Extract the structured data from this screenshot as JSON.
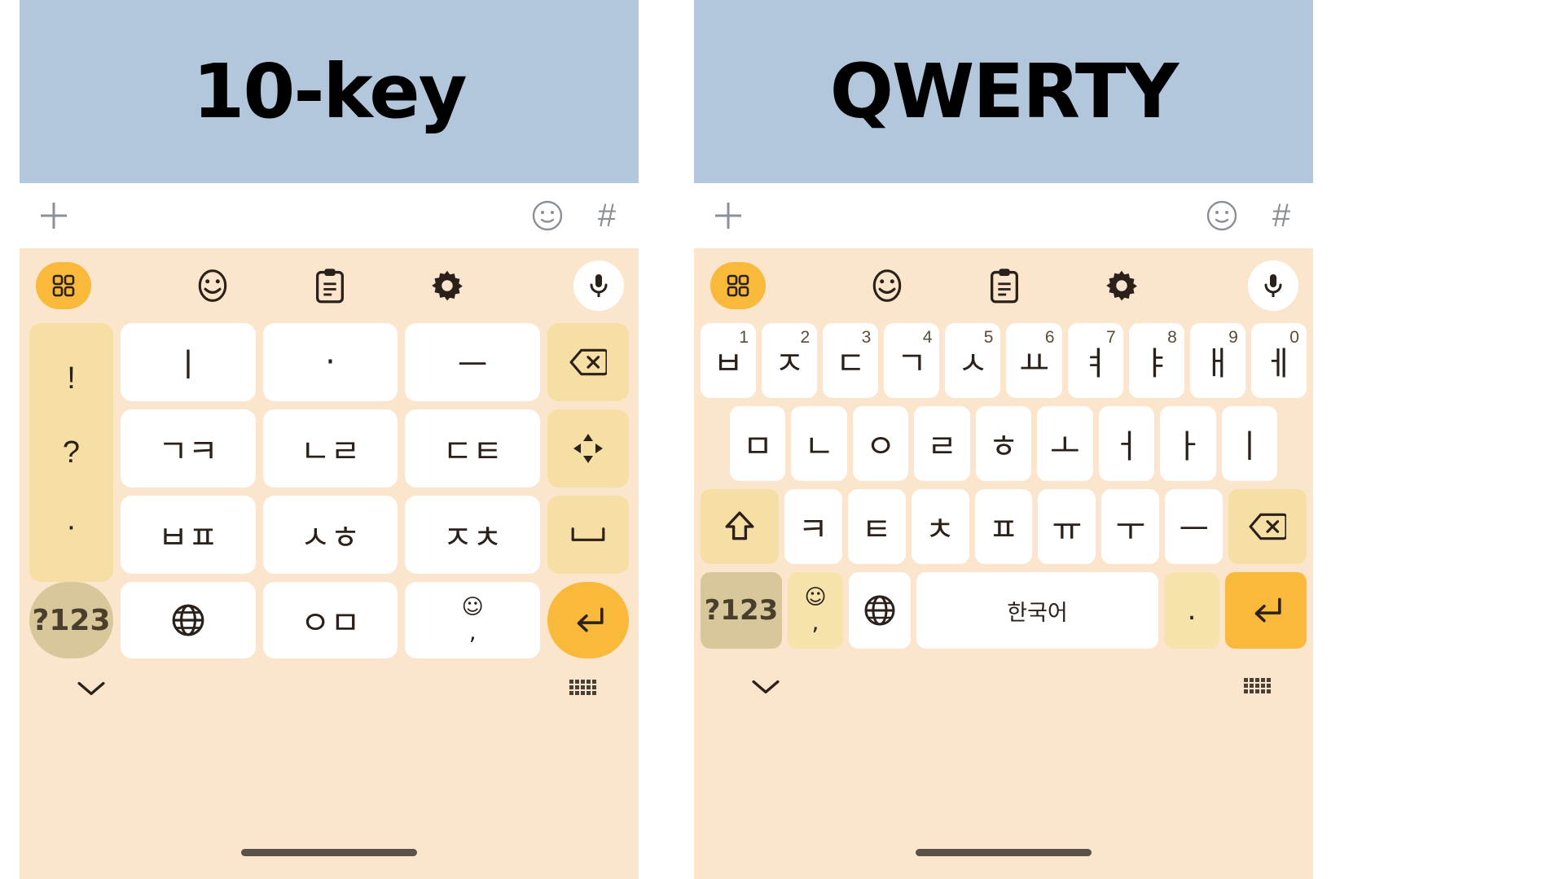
{
  "panels": [
    {
      "id": "ten-key",
      "banner_title": "10-key",
      "banner_color": "#b2c7dc",
      "app_toolbar": {
        "plus_icon": "plus-icon",
        "emoji_icon": "emoji-face-icon",
        "hash_label": "#"
      },
      "kb_toolbar": [
        {
          "name": "apps-grid-icon",
          "label": "",
          "style": "pill-orange"
        },
        {
          "name": "emoji-icon",
          "label": "",
          "style": "plain"
        },
        {
          "name": "clipboard-icon",
          "label": "",
          "style": "plain"
        },
        {
          "name": "settings-gear-icon",
          "label": "",
          "style": "plain"
        },
        {
          "name": "microphone-icon",
          "label": "",
          "style": "pill-white"
        }
      ],
      "punct_column": [
        "!",
        "?",
        "·"
      ],
      "rows": [
        [
          "ㅣ",
          "·",
          "ㅡ"
        ],
        [
          "ㄱㅋ",
          "ㄴㄹ",
          "ㄷㅌ"
        ],
        [
          "ㅂㅍ",
          "ㅅㅎ",
          "ㅈㅊ"
        ]
      ],
      "right_column": [
        {
          "name": "backspace-key",
          "label": "⌫"
        },
        {
          "name": "cursor-move-key",
          "label": "✛"
        },
        {
          "name": "space-key",
          "label": "␣"
        }
      ],
      "bottom_row": [
        {
          "name": "symbols-key",
          "label": "?123"
        },
        {
          "name": "language-globe-key",
          "label": "🌐"
        },
        {
          "name": "ieung-mieum-key",
          "label": "ㅇㅁ"
        },
        {
          "name": "emoji-comma-key",
          "label_top": "☺",
          "label_bottom": ","
        },
        {
          "name": "enter-key",
          "label": "↵"
        }
      ],
      "footer": {
        "collapse_icon": "chevron-down-icon",
        "keyboard_switch_icon": "mini-keyboard-icon"
      }
    },
    {
      "id": "qwerty",
      "banner_title": "QWERTY",
      "banner_color": "#b2c7dc",
      "app_toolbar": {
        "plus_icon": "plus-icon",
        "emoji_icon": "emoji-face-icon",
        "hash_label": "#"
      },
      "kb_toolbar": [
        {
          "name": "apps-grid-icon",
          "label": "",
          "style": "pill-orange"
        },
        {
          "name": "emoji-icon",
          "label": "",
          "style": "plain"
        },
        {
          "name": "clipboard-icon",
          "label": "",
          "style": "plain"
        },
        {
          "name": "settings-gear-icon",
          "label": "",
          "style": "plain"
        },
        {
          "name": "microphone-icon",
          "label": "",
          "style": "pill-white"
        }
      ],
      "row1": [
        {
          "char": "ㅂ",
          "num": "1"
        },
        {
          "char": "ㅈ",
          "num": "2"
        },
        {
          "char": "ㄷ",
          "num": "3"
        },
        {
          "char": "ㄱ",
          "num": "4"
        },
        {
          "char": "ㅅ",
          "num": "5"
        },
        {
          "char": "ㅛ",
          "num": "6"
        },
        {
          "char": "ㅕ",
          "num": "7"
        },
        {
          "char": "ㅑ",
          "num": "8"
        },
        {
          "char": "ㅐ",
          "num": "9"
        },
        {
          "char": "ㅔ",
          "num": "0"
        }
      ],
      "row2": [
        "ㅁ",
        "ㄴ",
        "ㅇ",
        "ㄹ",
        "ㅎ",
        "ㅗ",
        "ㅓ",
        "ㅏ",
        "ㅣ"
      ],
      "row3": {
        "shift": {
          "name": "shift-key",
          "label": "⇧"
        },
        "chars": [
          "ㅋ",
          "ㅌ",
          "ㅊ",
          "ㅍ",
          "ㅠ",
          "ㅜ",
          "ㅡ"
        ],
        "backspace": {
          "name": "backspace-key",
          "label": "⌫"
        }
      },
      "row4": [
        {
          "name": "symbols-key",
          "label": "?123"
        },
        {
          "name": "emoji-comma-key",
          "label_top": "☺",
          "label_bottom": ","
        },
        {
          "name": "language-globe-key",
          "label": "🌐"
        },
        {
          "name": "space-key",
          "label": "한국어"
        },
        {
          "name": "period-key",
          "label": "."
        },
        {
          "name": "enter-key",
          "label": "↵"
        }
      ],
      "footer": {
        "collapse_icon": "chevron-down-icon",
        "keyboard_switch_icon": "mini-keyboard-icon"
      }
    }
  ],
  "colors": {
    "banner": "#b2c7dc",
    "keyboard_bg": "#fbe6cd",
    "key_bg": "#ffffff",
    "fn_key_bg": "#f6dfa4",
    "accent": "#f9b93b",
    "tan": "#d8c79a",
    "text": "#2b211a"
  }
}
